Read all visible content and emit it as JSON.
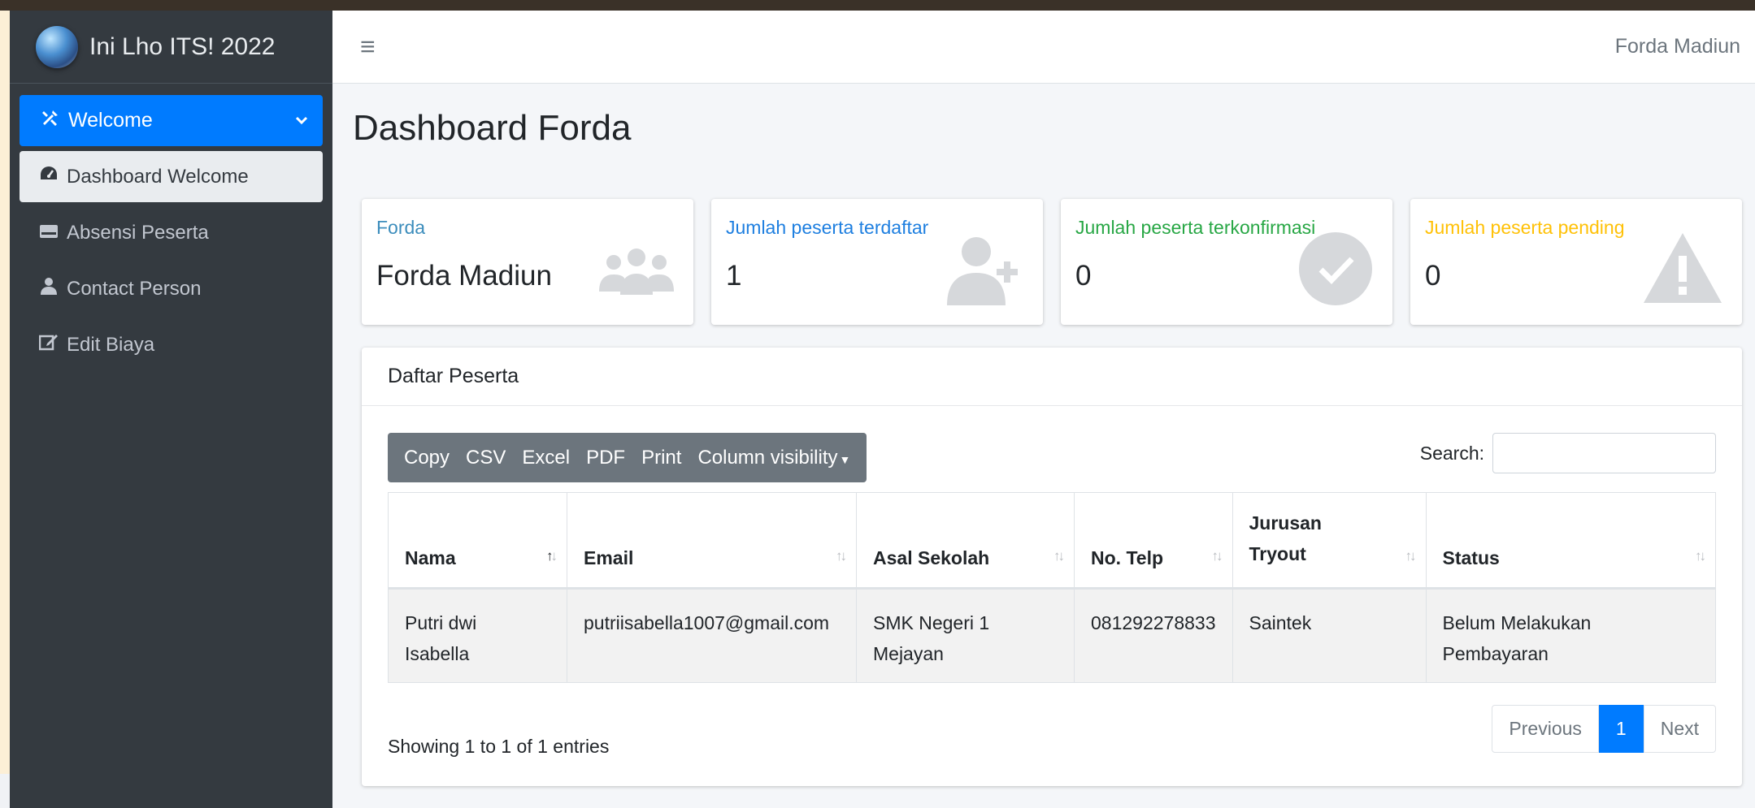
{
  "brand": {
    "title": "Ini Lho ITS! 2022"
  },
  "sidebar": {
    "parent": {
      "label": "Welcome",
      "icon": "tools-icon"
    },
    "items": [
      {
        "label": "Dashboard Welcome",
        "icon": "tachometer-icon",
        "active": true
      },
      {
        "label": "Absensi Peserta",
        "icon": "id-card-icon",
        "active": false
      },
      {
        "label": "Contact Person",
        "icon": "user-icon",
        "active": false
      },
      {
        "label": "Edit Biaya",
        "icon": "edit-icon",
        "active": false
      }
    ]
  },
  "topbar": {
    "user": "Forda Madiun"
  },
  "page": {
    "title": "Dashboard Forda"
  },
  "cards": [
    {
      "label": "Forda",
      "value": "Forda Madiun",
      "icon": "users-icon",
      "color": "#3c8dbc"
    },
    {
      "label": "Jumlah peserta terdaftar",
      "value": "1",
      "icon": "user-plus-icon",
      "color": "#1e7fe0"
    },
    {
      "label": "Jumlah peserta terkonfirmasi",
      "value": "0",
      "icon": "check-circle-icon",
      "color": "#28a745"
    },
    {
      "label": "Jumlah peserta pending",
      "value": "0",
      "icon": "warning-icon",
      "color": "#ffc107"
    }
  ],
  "table": {
    "title": "Daftar Peserta",
    "buttons": [
      "Copy",
      "CSV",
      "Excel",
      "PDF",
      "Print",
      "Column visibility"
    ],
    "search_label": "Search:",
    "search_value": "",
    "columns": [
      "Nama",
      "Email",
      "Asal Sekolah",
      "No. Telp",
      "Jurusan Tryout",
      "Status"
    ],
    "rows": [
      [
        "Putri dwi Isabella",
        "putriisabella1007@gmail.com",
        "SMK Negeri 1 Mejayan",
        "081292278833",
        "Saintek",
        "Belum Melakukan Pembayaran"
      ]
    ],
    "info": "Showing 1 to 1 of 1 entries",
    "pager": {
      "previous": "Previous",
      "current": "1",
      "next": "Next"
    }
  }
}
